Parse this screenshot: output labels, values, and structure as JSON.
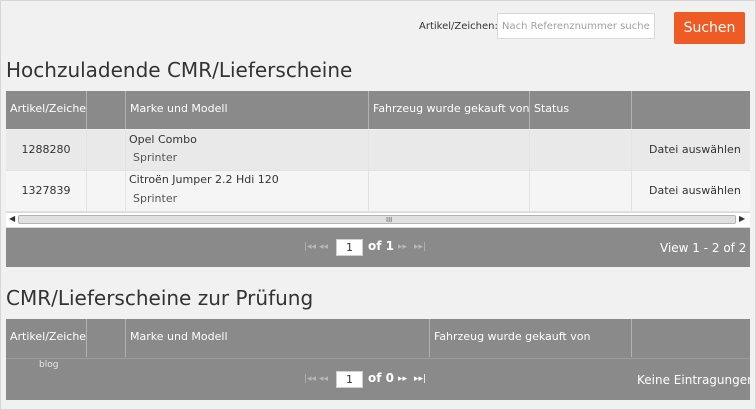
{
  "search": {
    "label": "Artikel/Zeichen:",
    "placeholder": "Nach Referenznummer suchen",
    "button": "Suchen"
  },
  "upload_section": {
    "title": "Hochzuladende CMR/Lieferscheine",
    "columns": [
      "Artikel/Zeichen",
      "",
      "Marke und Modell",
      "Fahrzeug wurde gekauft von",
      "Status",
      ""
    ],
    "rows": [
      {
        "article": "1288280",
        "model": "Opel Combo",
        "variant": "Sprinter",
        "bought_from": "",
        "status": "",
        "action": "Datei auswählen"
      },
      {
        "article": "1327839",
        "model": "Citroën Jumper 2.2 Hdi 120",
        "variant": "Sprinter",
        "bought_from": "",
        "status": "",
        "action": "Datei auswählen"
      }
    ],
    "scroll_grip": "III",
    "pager": {
      "first": "|◂◂",
      "prev": "◂◂",
      "page": "1",
      "of_text": "of 1",
      "next": "▸▸",
      "last": "▸▸|",
      "info": "View 1 - 2 of 2"
    }
  },
  "review_section": {
    "title": "CMR/Lieferscheine zur Prüfung",
    "columns": [
      "Artikel/Zeichen",
      "",
      "Marke und Modell",
      "Fahrzeug wurde gekauft von",
      ""
    ],
    "watermark": "blog",
    "pager": {
      "first": "|◂◂",
      "prev": "◂◂",
      "page": "1",
      "of_text": "of 0",
      "next": "▸▸",
      "last": "▸▸|",
      "info": "Keine Eintragungen"
    }
  },
  "colors": {
    "accent": "#ee5b25",
    "grid_header": "#8a8a8a",
    "background": "#f1f1f1"
  },
  "icons": [
    "pager-first-icon",
    "pager-prev-icon",
    "pager-next-icon",
    "pager-last-icon",
    "scroll-left-icon",
    "scroll-right-icon"
  ]
}
